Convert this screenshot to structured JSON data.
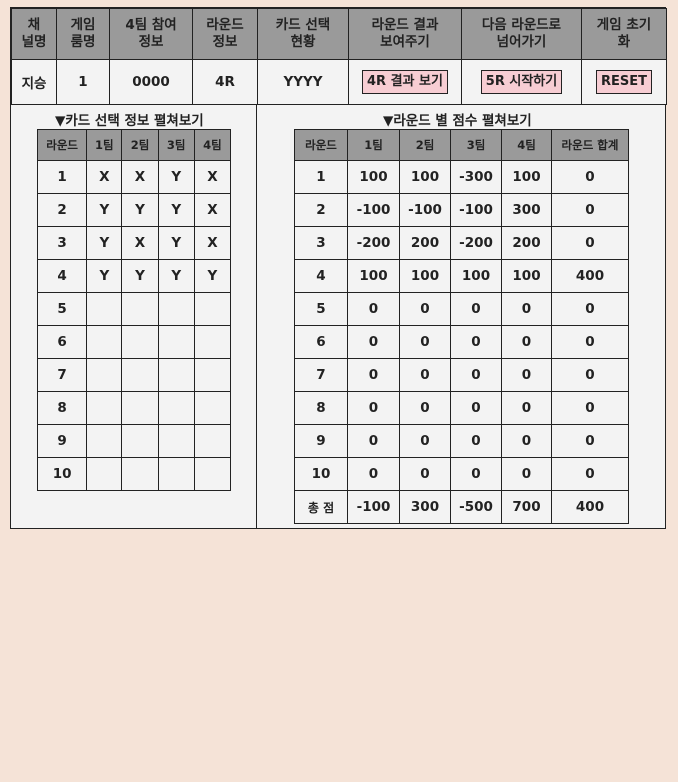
{
  "header": {
    "columns": [
      "채널명",
      "게임룸명",
      "4팀 참여 정보",
      "라운드 정보",
      "카드 선택 현황",
      "라운드 결과 보여주기",
      "다음 라운드로 넘어가기",
      "게임 초기화"
    ],
    "columns_lines": [
      [
        "채",
        "널명"
      ],
      [
        "게임",
        "룸명"
      ],
      [
        "4팀 참여",
        "정보"
      ],
      [
        "라운드",
        "정보"
      ],
      [
        "카드 선택",
        "현황"
      ],
      [
        "라운드 결과",
        "보여주기"
      ],
      [
        "다음 라운드로",
        "넘어가기"
      ],
      [
        "게임 초기",
        "화"
      ]
    ],
    "values": {
      "channel": "지승",
      "room": "1",
      "team_join": "0000",
      "round": "4R",
      "card_status": "YYYY",
      "show_result_button": "4R 결과 보기",
      "next_round_button": "5R 시작하기",
      "reset_button": "RESET"
    },
    "button_color": "#f7cdd3"
  },
  "card_section": {
    "title": "▼카드 선택 정보 펼쳐보기",
    "headers": [
      "라운드",
      "1팀",
      "2팀",
      "3팀",
      "4팀"
    ],
    "rows": [
      [
        "1",
        "X",
        "X",
        "Y",
        "X"
      ],
      [
        "2",
        "Y",
        "Y",
        "Y",
        "X"
      ],
      [
        "3",
        "Y",
        "X",
        "Y",
        "X"
      ],
      [
        "4",
        "Y",
        "Y",
        "Y",
        "Y"
      ],
      [
        "5",
        "",
        "",
        "",
        ""
      ],
      [
        "6",
        "",
        "",
        "",
        ""
      ],
      [
        "7",
        "",
        "",
        "",
        ""
      ],
      [
        "8",
        "",
        "",
        "",
        ""
      ],
      [
        "9",
        "",
        "",
        "",
        ""
      ],
      [
        "10",
        "",
        "",
        "",
        ""
      ]
    ]
  },
  "score_section": {
    "title": "▼라운드 별 점수 펼쳐보기",
    "headers": [
      "라운드",
      "1팀",
      "2팀",
      "3팀",
      "4팀",
      "라운드 합계"
    ],
    "rows": [
      [
        "1",
        "100",
        "100",
        "-300",
        "100",
        "0"
      ],
      [
        "2",
        "-100",
        "-100",
        "-100",
        "300",
        "0"
      ],
      [
        "3",
        "-200",
        "200",
        "-200",
        "200",
        "0"
      ],
      [
        "4",
        "100",
        "100",
        "100",
        "100",
        "400"
      ],
      [
        "5",
        "0",
        "0",
        "0",
        "0",
        "0"
      ],
      [
        "6",
        "0",
        "0",
        "0",
        "0",
        "0"
      ],
      [
        "7",
        "0",
        "0",
        "0",
        "0",
        "0"
      ],
      [
        "8",
        "0",
        "0",
        "0",
        "0",
        "0"
      ],
      [
        "9",
        "0",
        "0",
        "0",
        "0",
        "0"
      ],
      [
        "10",
        "0",
        "0",
        "0",
        "0",
        "0"
      ]
    ],
    "total_row": [
      "총 점",
      "-100",
      "300",
      "-500",
      "700",
      "400"
    ]
  },
  "colors": {
    "page_background": "#f5e3d7",
    "panel_background": "#f3f3f3",
    "header_gray": "#9a9a9a"
  }
}
